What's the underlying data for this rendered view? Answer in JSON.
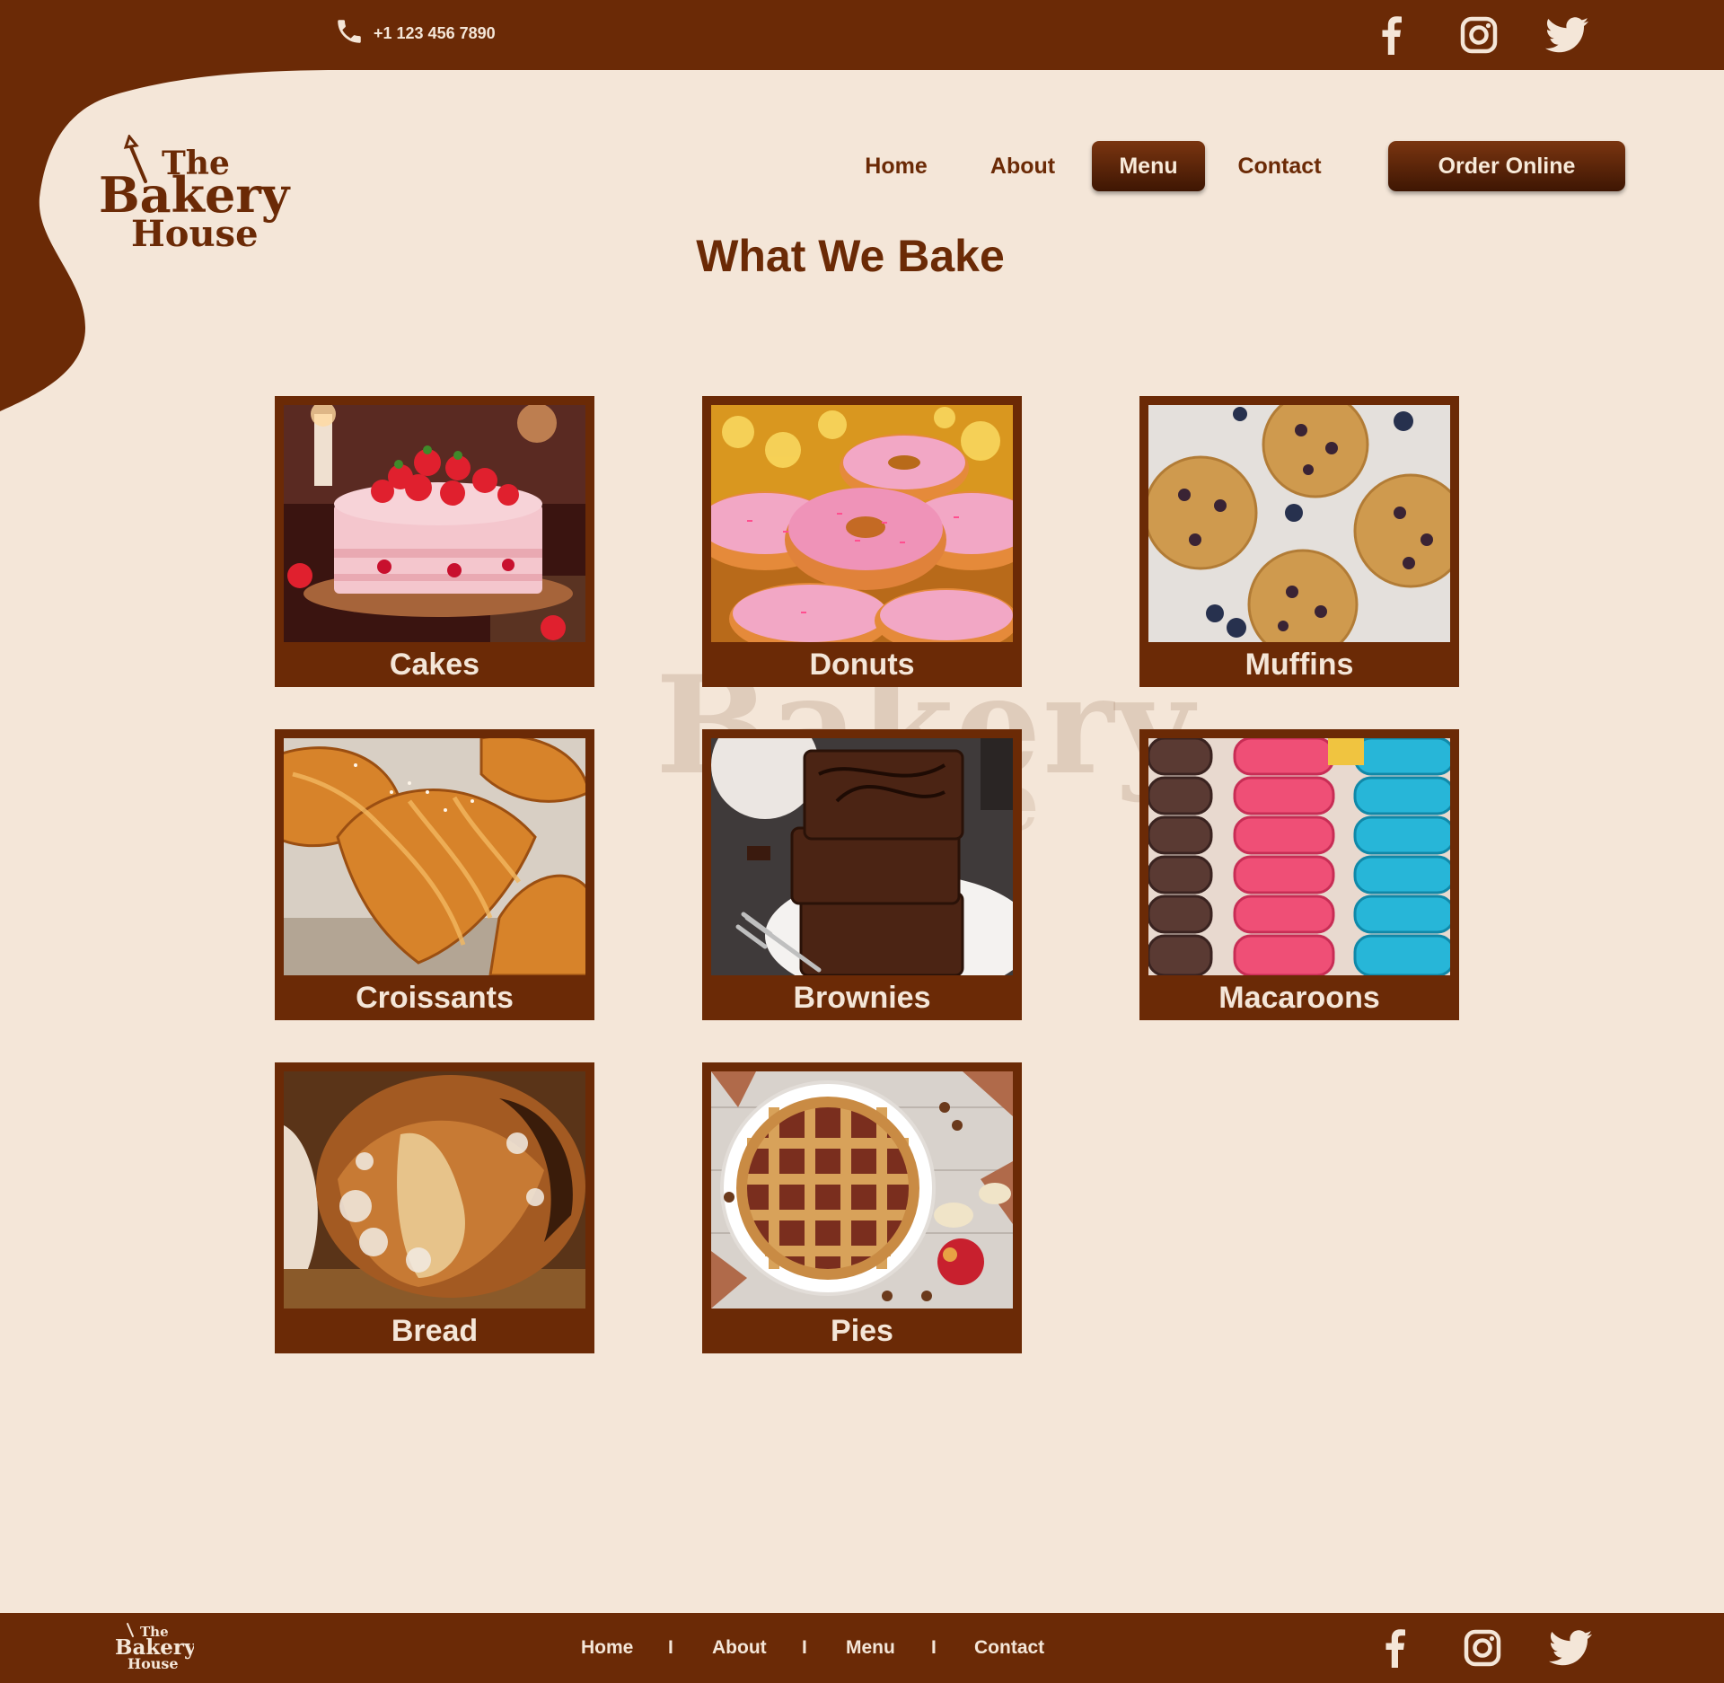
{
  "colors": {
    "brand": "#6b2a06",
    "background": "#f4e6d8",
    "button_dark": "#3e1603",
    "text_light": "#f4e6d8"
  },
  "topbar": {
    "phone": "+1 123 456 7890",
    "phone_icon": "phone-icon",
    "social_icons": [
      "facebook-icon",
      "instagram-icon",
      "twitter-icon"
    ]
  },
  "logo": {
    "line1": "The",
    "line2": "Bakery",
    "line3": "House"
  },
  "nav": {
    "items": [
      {
        "label": "Home"
      },
      {
        "label": "About"
      },
      {
        "label": "Menu",
        "active": true
      },
      {
        "label": "Contact"
      }
    ],
    "cta": "Order Online"
  },
  "main": {
    "title": "What We Bake",
    "watermark": "Bakery",
    "watermark2": "e",
    "items": [
      {
        "label": "Cakes"
      },
      {
        "label": "Donuts"
      },
      {
        "label": "Muffins"
      },
      {
        "label": "Croissants"
      },
      {
        "label": "Brownies"
      },
      {
        "label": "Macaroons"
      },
      {
        "label": "Bread"
      },
      {
        "label": "Pies"
      }
    ]
  },
  "footer": {
    "logo": {
      "line1": "The",
      "line2": "Bakery",
      "line3": "House"
    },
    "links": [
      {
        "label": "Home"
      },
      {
        "label": "About"
      },
      {
        "label": "Menu"
      },
      {
        "label": "Contact"
      }
    ],
    "separator": "I",
    "social_icons": [
      "facebook-icon",
      "instagram-icon",
      "twitter-icon"
    ]
  }
}
